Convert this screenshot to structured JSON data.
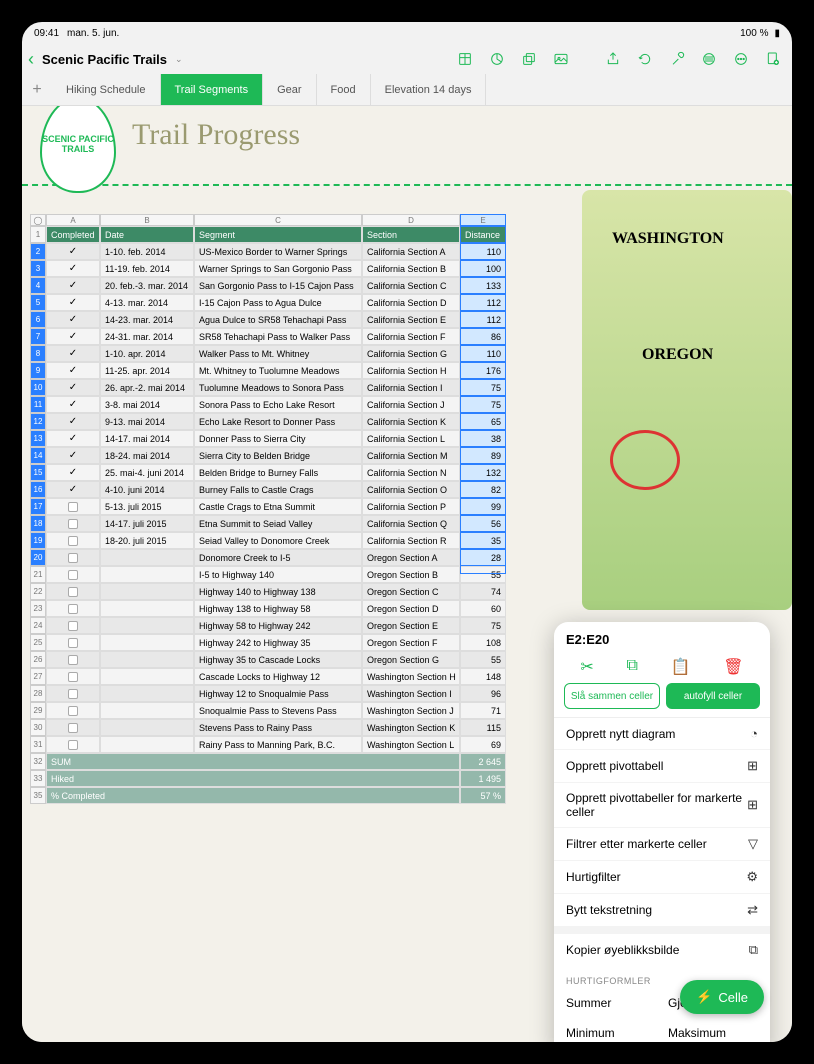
{
  "status": {
    "time": "09:41",
    "date": "man. 5. jun.",
    "battery": "100 %"
  },
  "document": {
    "title": "Scenic Pacific Trails"
  },
  "toolbarIcons": [
    "table",
    "chart",
    "shape",
    "media",
    "share",
    "undo",
    "tools",
    "format",
    "more",
    "new"
  ],
  "tabs": [
    {
      "label": "Hiking Schedule",
      "active": false
    },
    {
      "label": "Trail Segments",
      "active": true
    },
    {
      "label": "Gear",
      "active": false
    },
    {
      "label": "Food",
      "active": false
    },
    {
      "label": "Elevation 14 days",
      "active": false
    }
  ],
  "page": {
    "logoText": "SCENIC PACIFIC TRAILS",
    "title": "Trail Progress"
  },
  "columns": [
    "A",
    "B",
    "C",
    "D",
    "E"
  ],
  "headers": {
    "completed": "Completed",
    "date": "Date",
    "segment": "Segment",
    "section": "Section",
    "distance": "Distance"
  },
  "rows": [
    {
      "n": 2,
      "c": true,
      "date": "1-10. feb. 2014",
      "seg": "US-Mexico Border to Warner Springs",
      "sec": "California Section A",
      "dist": "110"
    },
    {
      "n": 3,
      "c": true,
      "date": "11-19. feb. 2014",
      "seg": "Warner Springs to San Gorgonio Pass",
      "sec": "California Section B",
      "dist": "100"
    },
    {
      "n": 4,
      "c": true,
      "date": "20. feb.-3. mar. 2014",
      "seg": "San Gorgonio Pass to I-15 Cajon Pass",
      "sec": "California Section C",
      "dist": "133"
    },
    {
      "n": 5,
      "c": true,
      "date": "4-13. mar. 2014",
      "seg": "I-15 Cajon Pass to Agua Dulce",
      "sec": "California Section D",
      "dist": "112"
    },
    {
      "n": 6,
      "c": true,
      "date": "14-23. mar. 2014",
      "seg": "Agua Dulce to SR58 Tehachapi Pass",
      "sec": "California Section E",
      "dist": "112"
    },
    {
      "n": 7,
      "c": true,
      "date": "24-31. mar. 2014",
      "seg": "SR58 Tehachapi Pass to Walker Pass",
      "sec": "California Section F",
      "dist": "86"
    },
    {
      "n": 8,
      "c": true,
      "date": "1-10. apr. 2014",
      "seg": "Walker Pass to Mt. Whitney",
      "sec": "California Section G",
      "dist": "110"
    },
    {
      "n": 9,
      "c": true,
      "date": "11-25. apr. 2014",
      "seg": "Mt. Whitney to Tuolumne Meadows",
      "sec": "California Section H",
      "dist": "176"
    },
    {
      "n": 10,
      "c": true,
      "date": "26. apr.-2. mai 2014",
      "seg": "Tuolumne Meadows to Sonora Pass",
      "sec": "California Section I",
      "dist": "75"
    },
    {
      "n": 11,
      "c": true,
      "date": "3-8. mai 2014",
      "seg": "Sonora Pass to Echo Lake Resort",
      "sec": "California Section J",
      "dist": "75"
    },
    {
      "n": 12,
      "c": true,
      "date": "9-13. mai 2014",
      "seg": "Echo Lake Resort to Donner Pass",
      "sec": "California Section K",
      "dist": "65"
    },
    {
      "n": 13,
      "c": true,
      "date": "14-17. mai 2014",
      "seg": "Donner Pass to Sierra City",
      "sec": "California Section L",
      "dist": "38"
    },
    {
      "n": 14,
      "c": true,
      "date": "18-24. mai 2014",
      "seg": "Sierra City to Belden Bridge",
      "sec": "California Section M",
      "dist": "89"
    },
    {
      "n": 15,
      "c": true,
      "date": "25. mai-4. juni 2014",
      "seg": "Belden Bridge to Burney Falls",
      "sec": "California Section N",
      "dist": "132"
    },
    {
      "n": 16,
      "c": true,
      "date": "4-10. juni 2014",
      "seg": "Burney Falls to Castle Crags",
      "sec": "California Section O",
      "dist": "82"
    },
    {
      "n": 17,
      "c": false,
      "date": "5-13. juli 2015",
      "seg": "Castle Crags to Etna Summit",
      "sec": "California Section P",
      "dist": "99"
    },
    {
      "n": 18,
      "c": false,
      "date": "14-17. juli 2015",
      "seg": "Etna Summit to Seiad Valley",
      "sec": "California Section Q",
      "dist": "56"
    },
    {
      "n": 19,
      "c": false,
      "date": "18-20. juli 2015",
      "seg": "Seiad Valley to Donomore Creek",
      "sec": "California Section R",
      "dist": "35"
    },
    {
      "n": 20,
      "c": false,
      "date": "",
      "seg": "Donomore Creek to I-5",
      "sec": "Oregon Section A",
      "dist": "28"
    },
    {
      "n": 21,
      "c": false,
      "date": "",
      "seg": "I-5 to Highway 140",
      "sec": "Oregon Section B",
      "dist": "55"
    },
    {
      "n": 22,
      "c": false,
      "date": "",
      "seg": "Highway 140 to Highway 138",
      "sec": "Oregon Section C",
      "dist": "74"
    },
    {
      "n": 23,
      "c": false,
      "date": "",
      "seg": "Highway 138 to Highway 58",
      "sec": "Oregon Section D",
      "dist": "60"
    },
    {
      "n": 24,
      "c": false,
      "date": "",
      "seg": "Highway 58 to Highway 242",
      "sec": "Oregon Section E",
      "dist": "75"
    },
    {
      "n": 25,
      "c": false,
      "date": "",
      "seg": "Highway 242 to Highway 35",
      "sec": "Oregon Section F",
      "dist": "108"
    },
    {
      "n": 26,
      "c": false,
      "date": "",
      "seg": "Highway 35 to Cascade Locks",
      "sec": "Oregon Section G",
      "dist": "55"
    },
    {
      "n": 27,
      "c": false,
      "date": "",
      "seg": "Cascade Locks to Highway 12",
      "sec": "Washington Section H",
      "dist": "148"
    },
    {
      "n": 28,
      "c": false,
      "date": "",
      "seg": "Highway 12 to Snoqualmie Pass",
      "sec": "Washington Section I",
      "dist": "96"
    },
    {
      "n": 29,
      "c": false,
      "date": "",
      "seg": "Snoqualmie Pass to Stevens Pass",
      "sec": "Washington Section J",
      "dist": "71"
    },
    {
      "n": 30,
      "c": false,
      "date": "",
      "seg": "Stevens Pass to Rainy Pass",
      "sec": "Washington Section K",
      "dist": "115"
    },
    {
      "n": 31,
      "c": false,
      "date": "",
      "seg": "Rainy Pass to Manning Park, B.C.",
      "sec": "Washington Section L",
      "dist": "69"
    }
  ],
  "summary": [
    {
      "n": 32,
      "label": "SUM",
      "val": "2 645"
    },
    {
      "n": 33,
      "label": "Hiked",
      "val": "1 495"
    },
    {
      "n": 35,
      "label": "% Completed",
      "val": "57 %"
    }
  ],
  "selection": "E2:E20",
  "popover": {
    "actions": {
      "merge": "Slå sammen celler",
      "autofill": "autofyll celler"
    },
    "menu": [
      {
        "label": "Opprett nytt diagram",
        "icon": "◔"
      },
      {
        "label": "Opprett pivottabell",
        "icon": "⊞"
      },
      {
        "label": "Opprett pivottabeller for markerte celler",
        "icon": "⊞"
      },
      {
        "label": "Filtrer etter markerte celler",
        "icon": "▽"
      },
      {
        "label": "Hurtigfilter",
        "icon": "⚙"
      },
      {
        "label": "Bytt tekstretning",
        "icon": "⇄"
      },
      {
        "label": "Kopier øyeblikksbilde",
        "icon": "⧉"
      }
    ],
    "formulasTitle": "HURTIGFORMLER",
    "formulas": [
      "Summer",
      "Gjennomsnitt",
      "Minimum",
      "Maksimum"
    ]
  },
  "cellButton": "Celle",
  "map": {
    "washington": "WASHINGTON",
    "oregon": "OREGON"
  }
}
